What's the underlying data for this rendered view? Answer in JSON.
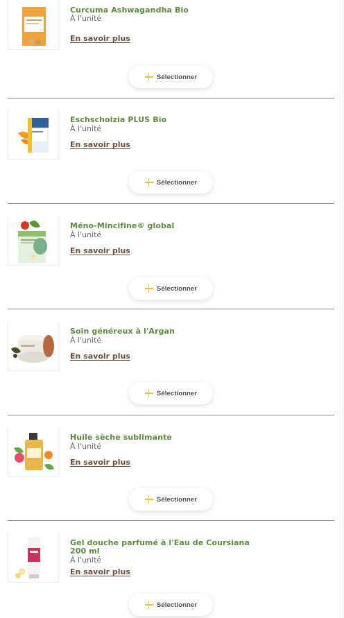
{
  "products": [
    {
      "name": "Curcuma Ashwagandha Bio",
      "unit": "À l'unité",
      "more_label": "En savoir plus",
      "select_label": "Sélectionner",
      "image_icon": "supplement-box-orange-icon"
    },
    {
      "name": "Eschscholzia PLUS Bio",
      "unit": "À l'unité",
      "more_label": "En savoir plus",
      "select_label": "Sélectionner",
      "image_icon": "supplement-box-blue-icon"
    },
    {
      "name": "Méno-Mincifine® global",
      "unit": "À l'unité",
      "more_label": "En savoir plus",
      "select_label": "Sélectionner",
      "image_icon": "supplement-box-green-icon"
    },
    {
      "name": "Soin généreux à l'Argan",
      "unit": "À l'unité",
      "more_label": "En savoir plus",
      "select_label": "Sélectionner",
      "image_icon": "cream-jar-icon"
    },
    {
      "name": "Huile sèche sublimante",
      "unit": "À l'unité",
      "more_label": "En savoir plus",
      "select_label": "Sélectionner",
      "image_icon": "oil-bottle-flowers-icon"
    },
    {
      "name": "Gel douche parfumé à l'Eau de Coursiana 200 ml",
      "unit": "À l'unité",
      "more_label": "En savoir plus",
      "select_label": "Sélectionner",
      "image_icon": "shower-gel-tube-icon"
    }
  ],
  "colors": {
    "product_name": "#5d8a3e",
    "link": "#6b4f3e",
    "plus_icon": "#e4c52f",
    "divider": "#8a8a8a"
  }
}
